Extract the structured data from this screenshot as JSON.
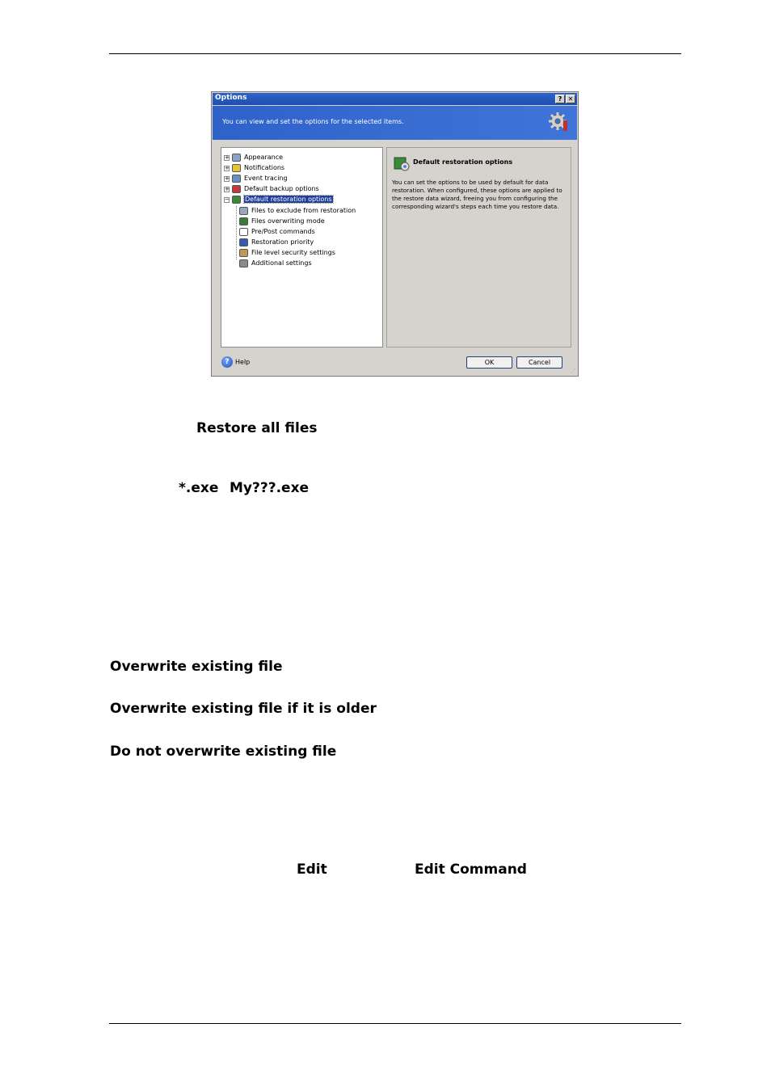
{
  "dialog": {
    "title": "Options",
    "help_btn": "?",
    "close_btn": "✕",
    "banner_text": "You can view and set the options for the selected items.",
    "tree": [
      {
        "label": "Appearance",
        "expander": "+",
        "color": "#8aa3c8"
      },
      {
        "label": "Notifications",
        "expander": "+",
        "color": "#e8c23a"
      },
      {
        "label": "Event tracing",
        "expander": "+",
        "color": "#6a8fc0"
      },
      {
        "label": "Default backup options",
        "expander": "+",
        "color": "#c23a3a"
      },
      {
        "label": "Default restoration options",
        "expander": "−",
        "color": "#3a8a3a",
        "selected": true
      },
      {
        "label": "Files to exclude from restoration",
        "color": "#9aa6c0"
      },
      {
        "label": "Files overwriting mode",
        "color": "#3a7a3a"
      },
      {
        "label": "Pre/Post commands",
        "color": "#ffffff"
      },
      {
        "label": "Restoration priority",
        "color": "#3a5ab0"
      },
      {
        "label": "File level security settings",
        "color": "#c09a50"
      },
      {
        "label": "Additional settings",
        "color": "#8a8a8a"
      }
    ],
    "info_title": "Default restoration options",
    "info_text": "You can set the options to be used by default for data restoration. When configured, these options are applied to the restore data wizard, freeing you from configuring the corresponding wizard's steps each time you restore data.",
    "help_label": "Help",
    "ok_label": "OK",
    "cancel_label": "Cancel"
  },
  "body": {
    "restore_all_files": "Restore all files",
    "mask1": "*.exe",
    "mask2": "My???.exe",
    "overwrite_existing": "Overwrite existing file",
    "overwrite_if_older": "Overwrite existing file if it is older",
    "do_not_overwrite": "Do not overwrite existing file",
    "edit": "Edit",
    "edit_command": "Edit Command"
  }
}
